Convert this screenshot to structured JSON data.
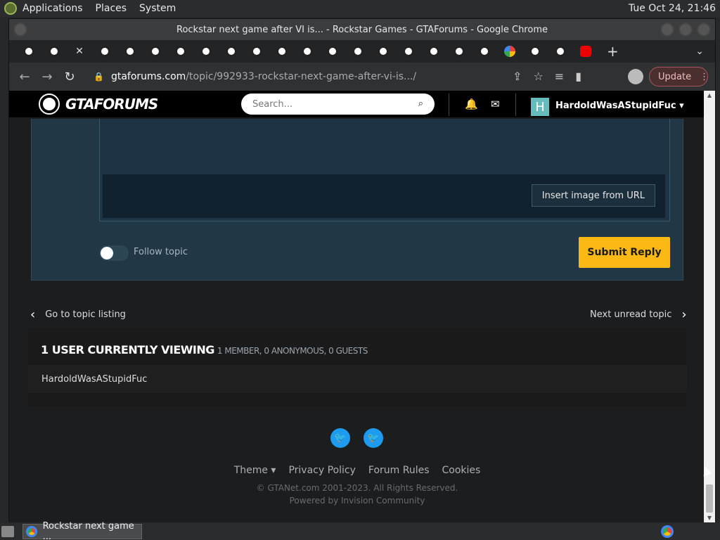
{
  "os_panel": {
    "menus": [
      "Applications",
      "Places",
      "System"
    ],
    "clock": "Tue Oct 24, 21:46"
  },
  "browser": {
    "window_title": "Rockstar next game after VI is... - Rockstar Games - GTAForums - Google Chrome",
    "url_host": "gtaforums.com",
    "url_path": "/topic/992933-rockstar-next-game-after-vi-is.../",
    "update_label": "Update",
    "tab_favicons": [
      "gtaforums",
      "gtaforums",
      "active",
      "gtaforums",
      "gtaforums",
      "gtaforums",
      "gtaforums",
      "gtaforums",
      "gtaforums",
      "gtaforums",
      "gtaforums",
      "gtaforums",
      "gtaforums",
      "gtaforums",
      "gtaforums",
      "gtaforums",
      "gtaforums",
      "gtaforums",
      "gtaforums",
      "google",
      "gtaforums",
      "gtaforums",
      "youtube"
    ]
  },
  "site_header": {
    "logo_text": "GTAFORUMS",
    "search_placeholder": "Search...",
    "user_initial": "H",
    "username": "HardoldWasAStupidFuc ▾"
  },
  "reply": {
    "insert_image_label": "Insert image from URL",
    "follow_label": "Follow topic",
    "submit_label": "Submit Reply"
  },
  "pagination": {
    "prev_label": "Go to topic listing",
    "next_label": "Next unread topic"
  },
  "viewing": {
    "heading": "1 USER CURRENTLY VIEWING",
    "detail": "1 MEMBER, 0 ANONYMOUS, 0 GUESTS",
    "users": [
      "HardoldWasAStupidFuc"
    ]
  },
  "footer": {
    "links": [
      "Theme ▾",
      "Privacy Policy",
      "Forum Rules",
      "Cookies"
    ],
    "copyright": "© GTANet.com 2001-2023. All Rights Reserved.",
    "powered": "Powered by Invision Community"
  },
  "taskbar": {
    "item_label": "Rockstar next game ..."
  },
  "colors": {
    "accent_yellow": "#fcb913",
    "reply_panel": "#213746",
    "twitter_blue": "#1d9bf0"
  }
}
